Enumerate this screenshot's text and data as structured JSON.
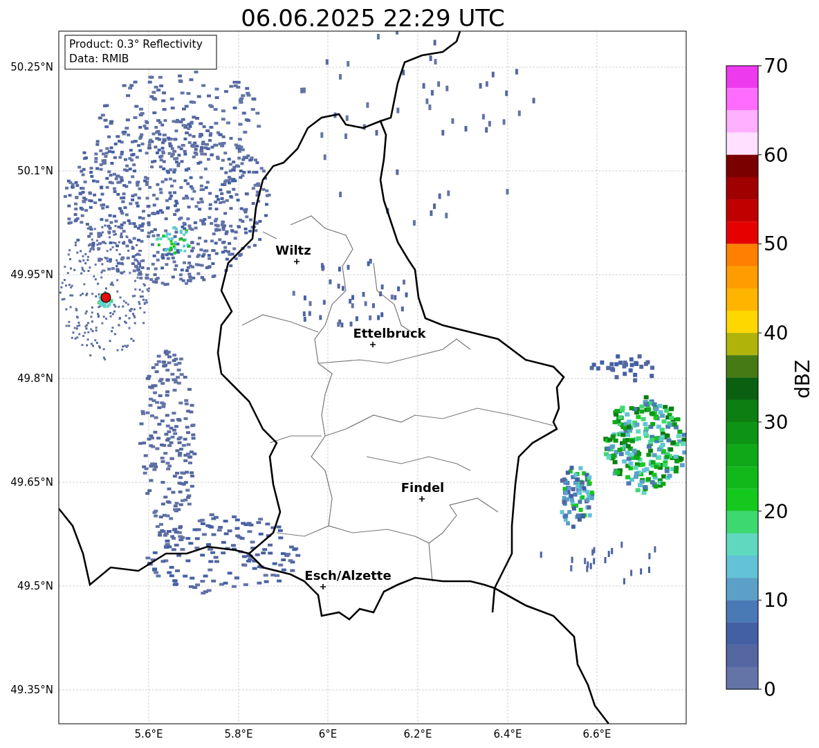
{
  "title": "06.06.2025 22:29 UTC",
  "info_box": [
    "Product: 0.3° Reflectivity",
    "Data: RMIB"
  ],
  "lat_ticks": [
    "50.25°N",
    "50.1°N",
    "49.95°N",
    "49.8°N",
    "49.65°N",
    "49.5°N",
    "49.35°N"
  ],
  "lon_ticks": [
    "5.6°E",
    "5.8°E",
    "6°E",
    "6.2°E",
    "6.4°E",
    "6.6°E"
  ],
  "cities": [
    {
      "name": "Wiltz"
    },
    {
      "name": "Ettelbruck"
    },
    {
      "name": "Findel"
    },
    {
      "name": "Esch/Alzette"
    }
  ],
  "colorbar": {
    "label": "dBZ",
    "ticks": [
      "70",
      "60",
      "50",
      "40",
      "30",
      "20",
      "10",
      "0"
    ],
    "segments": [
      {
        "color": "#ee3aee"
      },
      {
        "color": "#ff6cff"
      },
      {
        "color": "#ffb0ff"
      },
      {
        "color": "#ffe0ff"
      },
      {
        "color": "#7a0000"
      },
      {
        "color": "#a00000"
      },
      {
        "color": "#c00000"
      },
      {
        "color": "#e60000"
      },
      {
        "color": "#ff8000"
      },
      {
        "color": "#ff9c00"
      },
      {
        "color": "#ffb400"
      },
      {
        "color": "#ffd700"
      },
      {
        "color": "#b0b40a"
      },
      {
        "color": "#467a14"
      },
      {
        "color": "#0a6010"
      },
      {
        "color": "#0c7e12"
      },
      {
        "color": "#0e9414"
      },
      {
        "color": "#10a818"
      },
      {
        "color": "#12b81a"
      },
      {
        "color": "#14c81e"
      },
      {
        "color": "#3ed870"
      },
      {
        "color": "#5fd8c0"
      },
      {
        "color": "#62c2d8"
      },
      {
        "color": "#5ca0c8"
      },
      {
        "color": "#4a7ab5"
      },
      {
        "color": "#4460a4"
      },
      {
        "color": "#5467a0"
      },
      {
        "color": "#6474a6"
      }
    ]
  }
}
